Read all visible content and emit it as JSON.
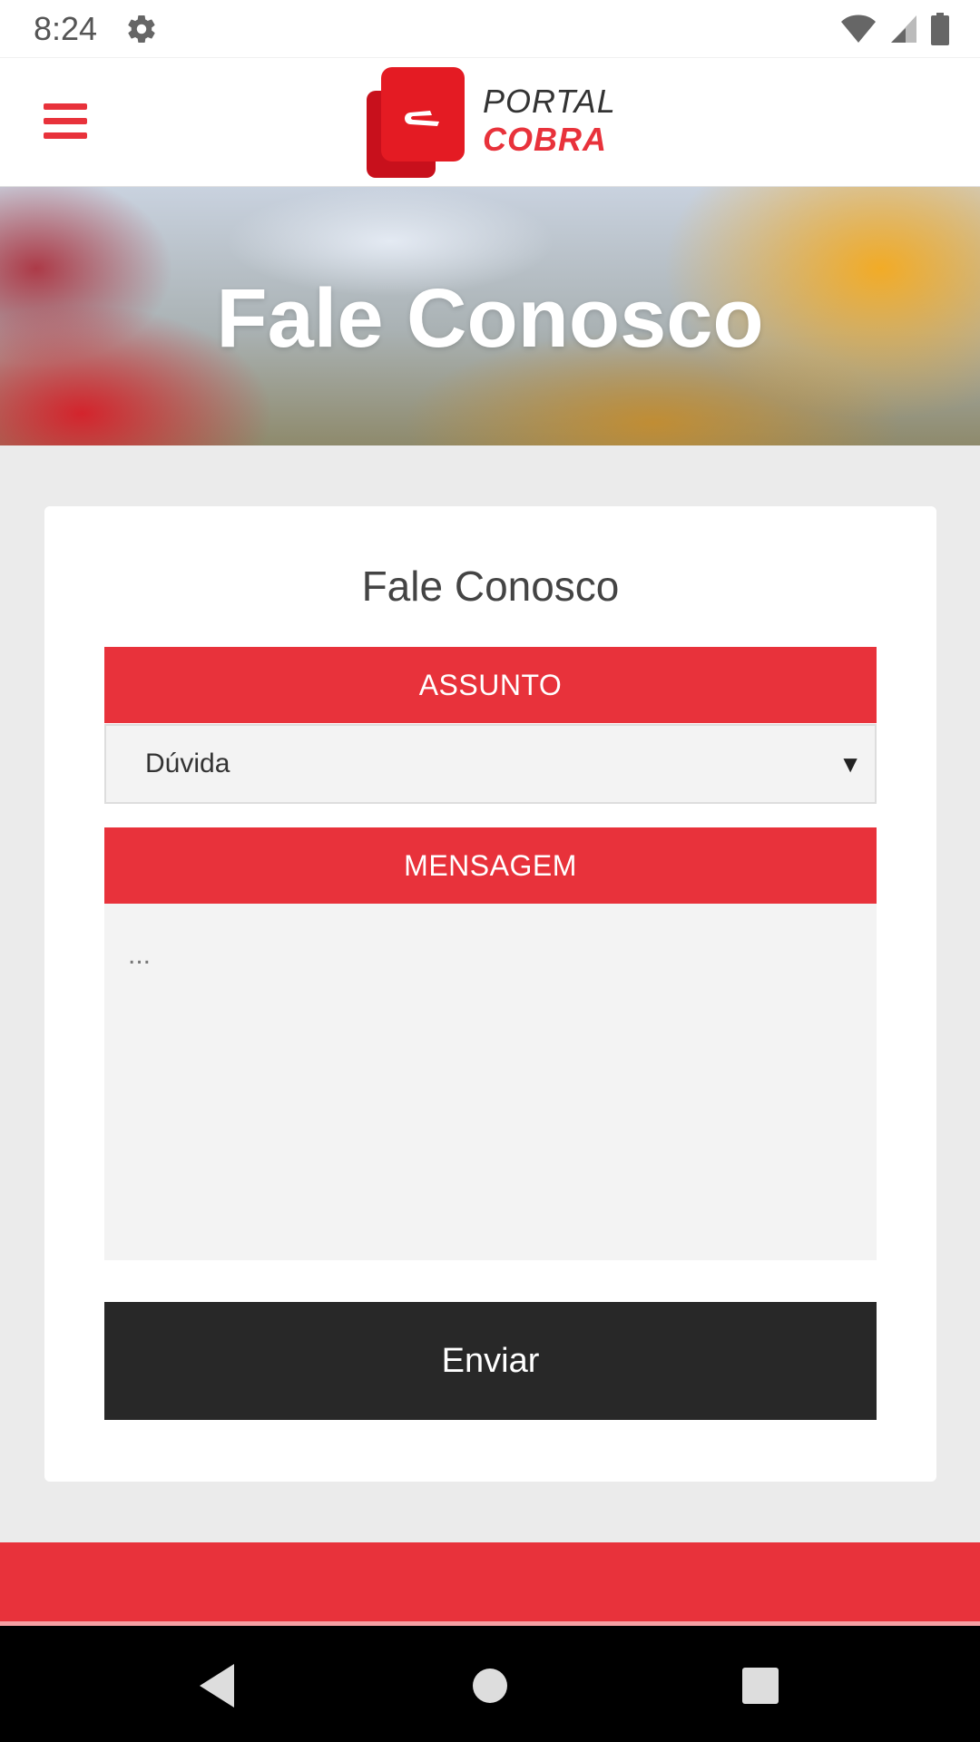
{
  "status_bar": {
    "time": "8:24",
    "icons": [
      "settings-gear-icon",
      "wifi-icon",
      "cellular-signal-icon",
      "battery-icon"
    ]
  },
  "header": {
    "menu_icon": "hamburger-menu-icon",
    "logo": {
      "line1": "PORTAL",
      "line2": "COBRA"
    }
  },
  "hero": {
    "title": "Fale Conosco"
  },
  "form": {
    "title": "Fale Conosco",
    "subject": {
      "header": "ASSUNTO",
      "selected": "Dúvida",
      "arrow": "▼"
    },
    "message": {
      "header": "MENSAGEM",
      "placeholder": "...",
      "value": ""
    },
    "submit_label": "Enviar"
  },
  "nav_bar": {
    "icons": [
      "back-icon",
      "home-icon",
      "recents-icon"
    ]
  },
  "colors": {
    "brand_red": "#e8323b",
    "button_dark": "#282828",
    "page_bg": "#ebebeb"
  }
}
